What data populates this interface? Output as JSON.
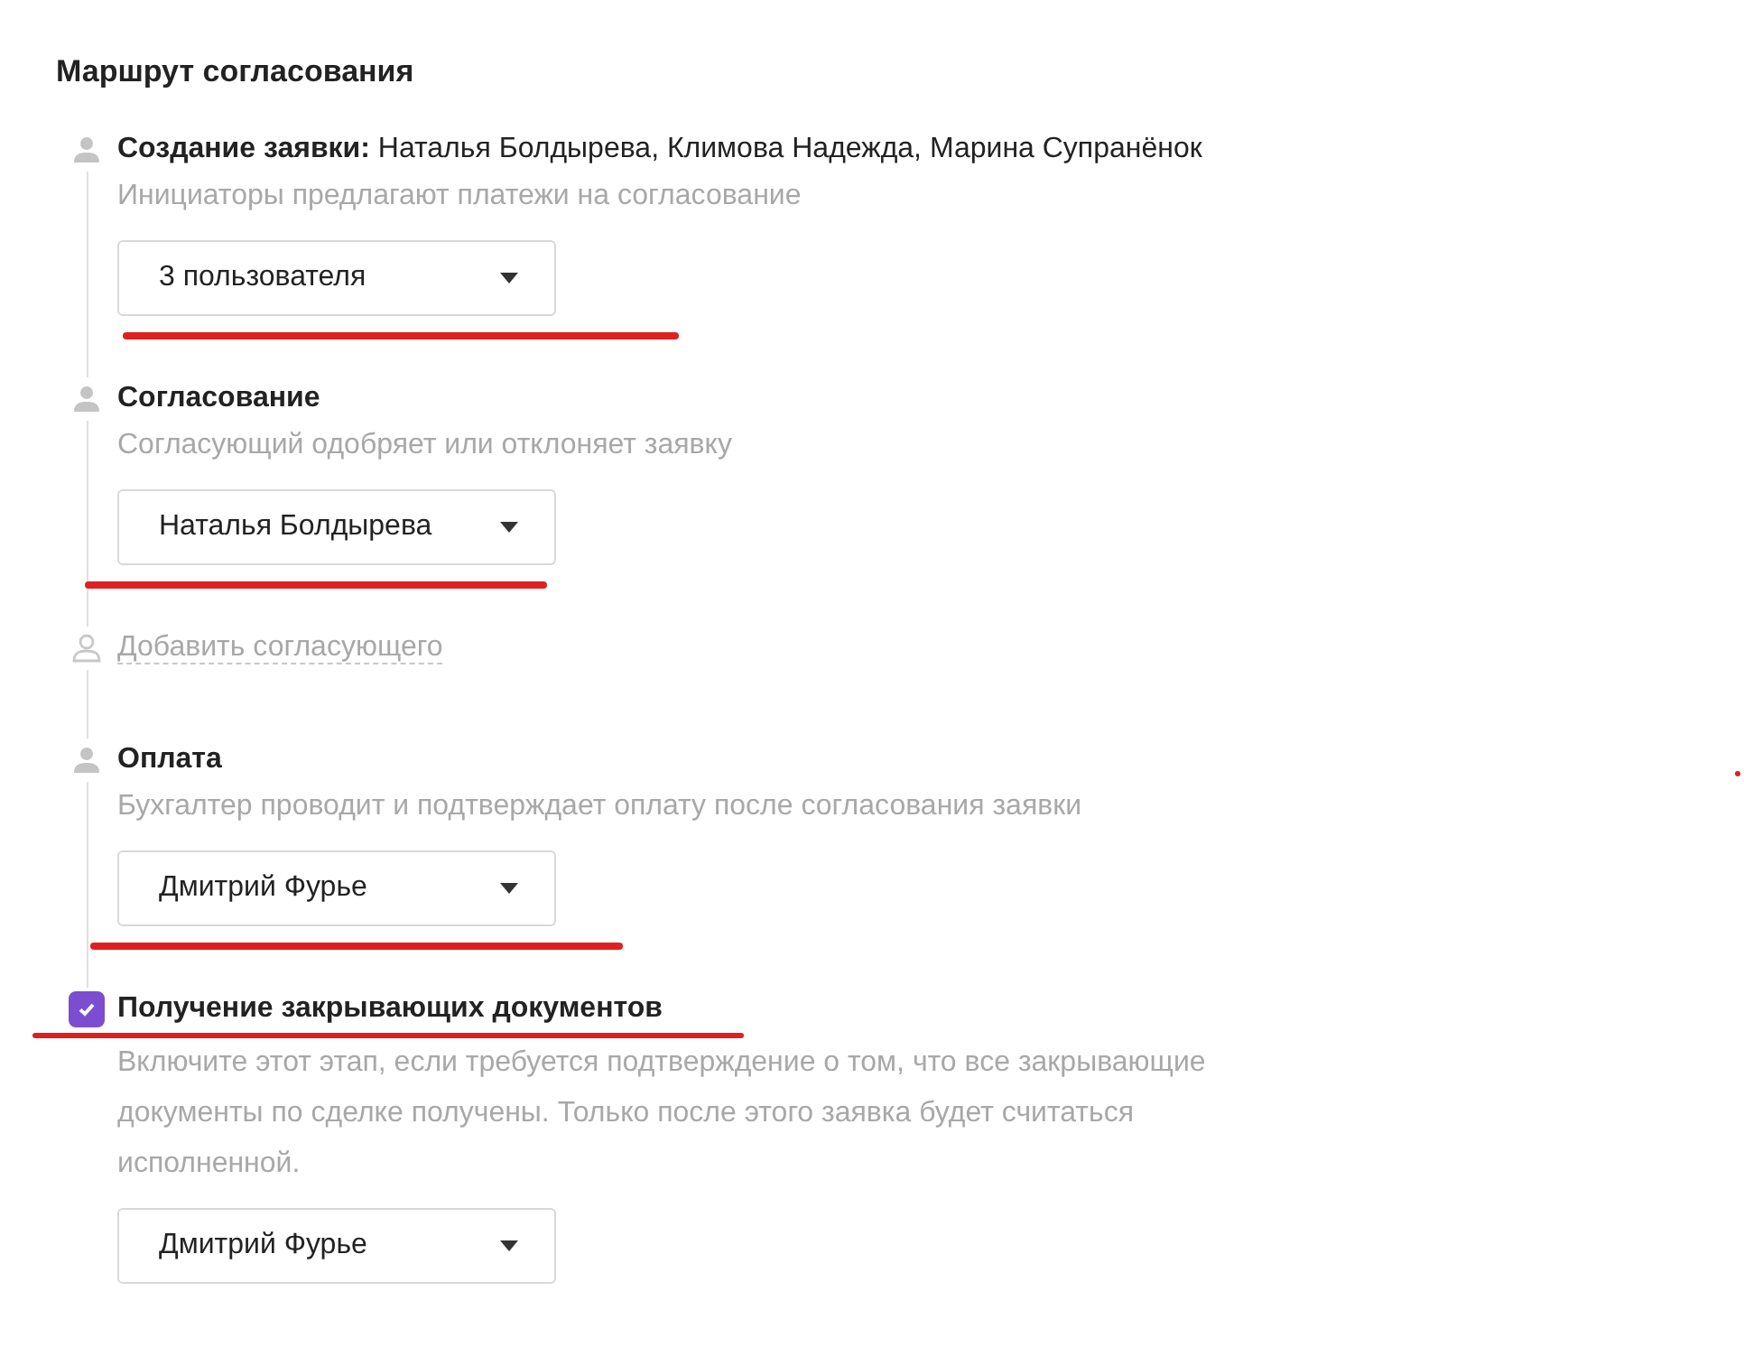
{
  "heading": "Маршрут согласования",
  "steps": [
    {
      "kind": "step",
      "title": "Создание заявки:",
      "people": "Наталья Болдырева, Климова Надежда, Марина Супранёнок",
      "description": "Инициаторы предлагают платежи на согласование",
      "dropdown": "3 пользователя",
      "dropdown_underlined": true
    },
    {
      "kind": "step",
      "title": "Согласование",
      "description": "Согласующий одобряет или отклоняет заявку",
      "dropdown": "Наталья Болдырева",
      "dropdown_underlined": true
    },
    {
      "kind": "add",
      "label": "Добавить согласующего"
    },
    {
      "kind": "step",
      "title": "Оплата",
      "description": "Бухгалтер проводит и подтверждает оплату после согласования заявки",
      "dropdown": "Дмитрий Фурье",
      "dropdown_underlined": true
    },
    {
      "kind": "optional",
      "checked": true,
      "title": "Получение закрывающих документов",
      "description": "Включите этот этап, если требуется подтверждение о том, что все закрывающие документы по сделке получены. Только после этого заявка будет считаться исполненной.",
      "dropdown": "Дмитрий Фурье",
      "title_underlined": true
    }
  ],
  "marks": [
    {
      "kind": "dot"
    }
  ]
}
